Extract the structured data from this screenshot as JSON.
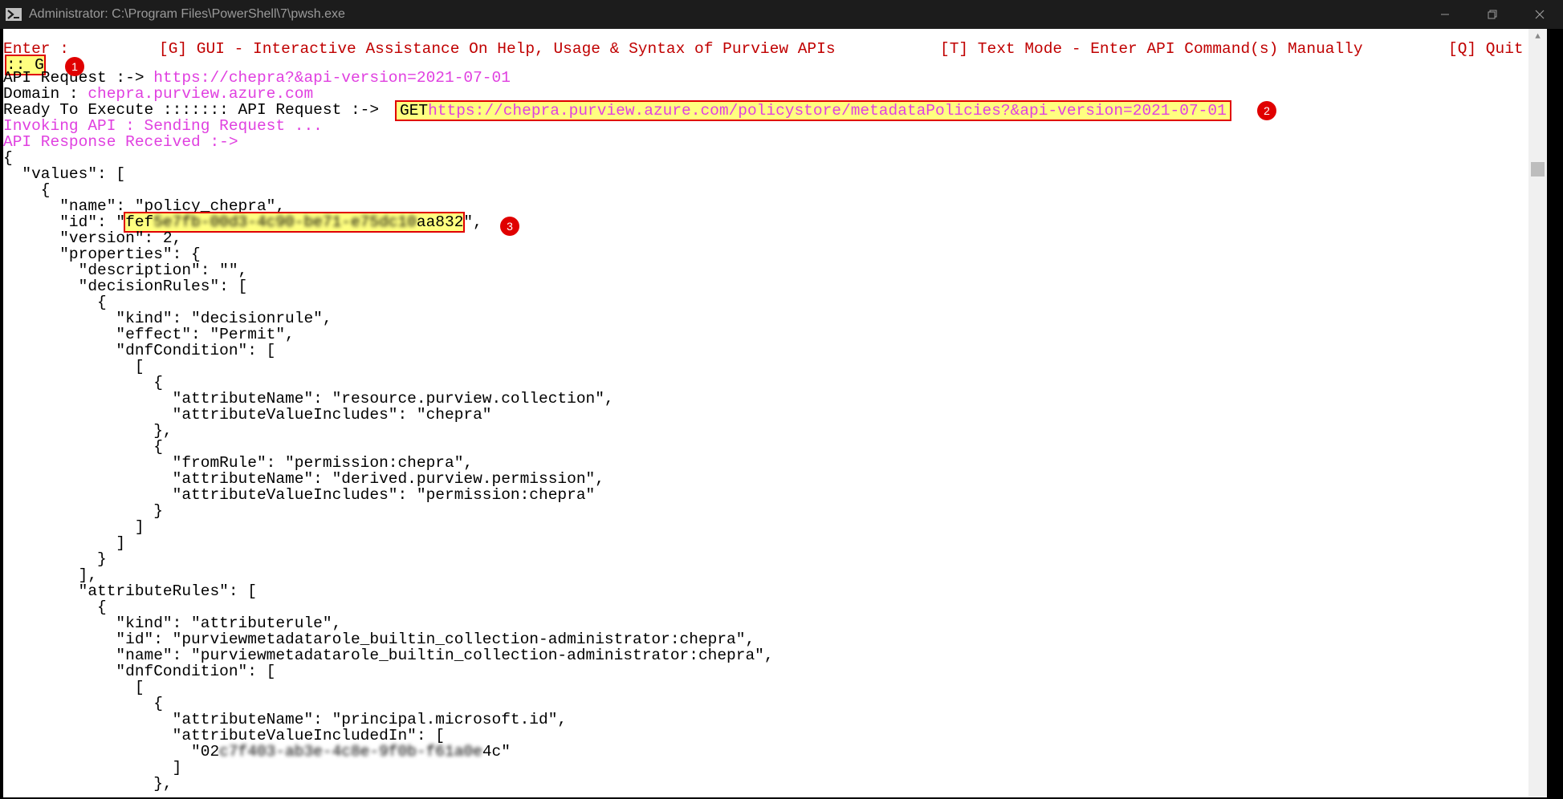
{
  "window": {
    "title": "Administrator: C:\\Program Files\\PowerShell\\7\\pwsh.exe",
    "icon": "powershell-icon"
  },
  "menu": {
    "enter_label": "Enter :",
    "opt_g": "[G] GUI - Interactive Assistance On Help, Usage & Syntax of Purview APIs",
    "opt_t": "[T] Text Mode - Enter API Command(s) Manually",
    "opt_q": "[Q] Quit"
  },
  "prompt": {
    "input": ":: G"
  },
  "request": {
    "api_label": "API Request :-> ",
    "api_url": "https://chepra?&api-version=2021-07-01",
    "domain_label": "Domain : ",
    "domain_value": "chepra.purview.azure.com",
    "ready_label": "Ready To Execute ::::::: API Request :-> ",
    "method": "GET",
    "full_url": "https://chepra.purview.azure.com/policystore/metadataPolicies?&api-version=2021-07-01",
    "invoking": "Invoking API : Sending Request ...",
    "received": "API Response Received :->"
  },
  "json": {
    "l01": "{",
    "l02": "  \"values\": [",
    "l03": "    {",
    "l04": "      \"name\": \"policy_chepra\",",
    "l05_prefix": "      \"id\": \"",
    "l05_a": "fef",
    "l05_blur": "5e7fb-00d3-4c90-be71-e75dc10",
    "l05_b": "aa832",
    "l05_suffix": "\",",
    "l06": "      \"version\": 2,",
    "l07": "      \"properties\": {",
    "l08": "        \"description\": \"\",",
    "l09": "        \"decisionRules\": [",
    "l10": "          {",
    "l11": "            \"kind\": \"decisionrule\",",
    "l12": "            \"effect\": \"Permit\",",
    "l13": "            \"dnfCondition\": [",
    "l14": "              [",
    "l15": "                {",
    "l16": "                  \"attributeName\": \"resource.purview.collection\",",
    "l17": "                  \"attributeValueIncludes\": \"chepra\"",
    "l18": "                },",
    "l19": "                {",
    "l20": "                  \"fromRule\": \"permission:chepra\",",
    "l21": "                  \"attributeName\": \"derived.purview.permission\",",
    "l22": "                  \"attributeValueIncludes\": \"permission:chepra\"",
    "l23": "                }",
    "l24": "              ]",
    "l25": "            ]",
    "l26": "          }",
    "l27": "        ],",
    "l28": "        \"attributeRules\": [",
    "l29": "          {",
    "l30": "            \"kind\": \"attributerule\",",
    "l31": "            \"id\": \"purviewmetadatarole_builtin_collection-administrator:chepra\",",
    "l32": "            \"name\": \"purviewmetadatarole_builtin_collection-administrator:chepra\",",
    "l33": "            \"dnfCondition\": [",
    "l34": "              [",
    "l35": "                {",
    "l36": "                  \"attributeName\": \"principal.microsoft.id\",",
    "l37": "                  \"attributeValueIncludedIn\": [",
    "l38_prefix": "                    \"02",
    "l38_blur": "c7f403-ab3e-4c8e-9f0b-f61a0e",
    "l38_b": "4c\"",
    "l39": "                  ]",
    "l40": "                },"
  },
  "badges": {
    "b1": "1",
    "b2": "2",
    "b3": "3"
  }
}
